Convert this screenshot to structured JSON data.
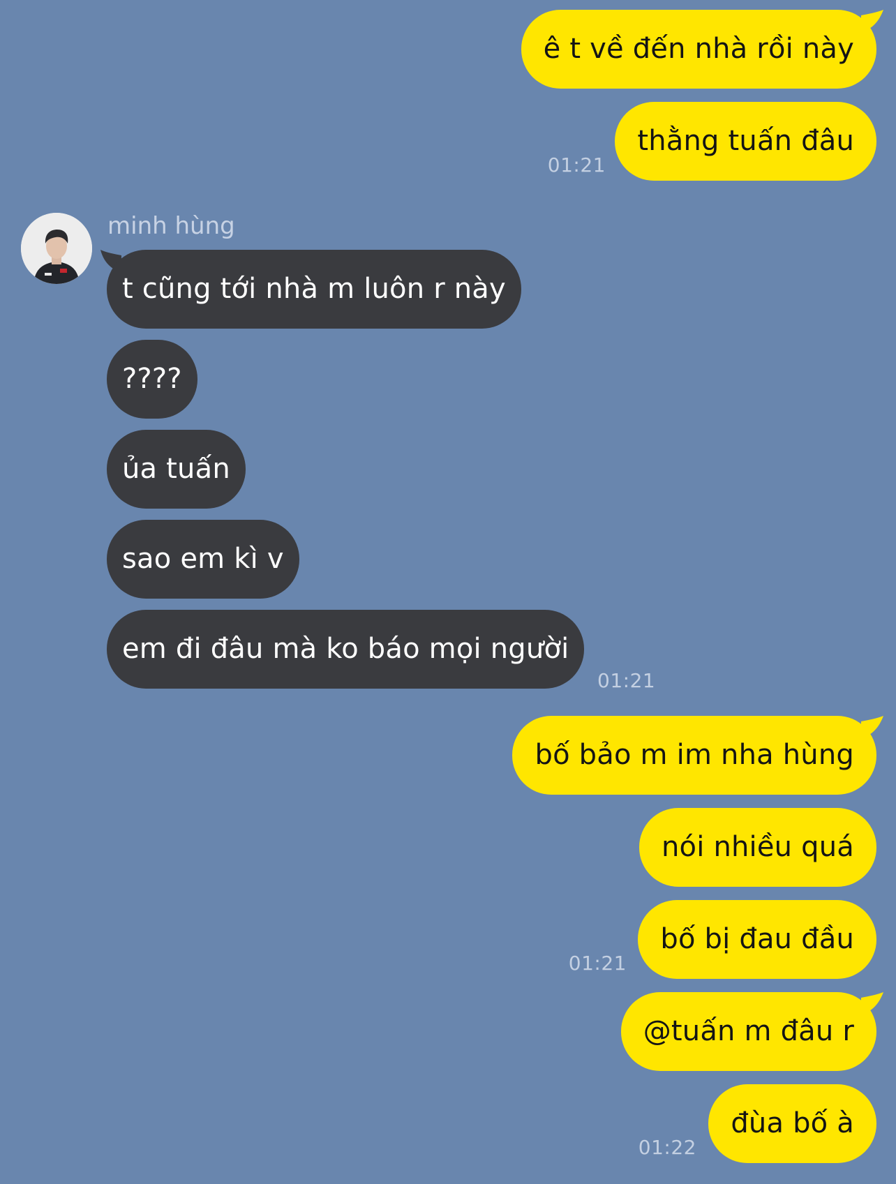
{
  "theme": {
    "background": "#6986AE",
    "outgoing_bubble": "#FFE600",
    "incoming_bubble": "#3A3B3F",
    "timestamp_color": "#C4D0E2"
  },
  "contact": {
    "name": "minh hùng",
    "avatar_icon": "person-avatar-icon"
  },
  "messages": [
    {
      "direction": "out",
      "text": "ê t về đến nhà rồi này"
    },
    {
      "direction": "out",
      "text": "thằng tuấn đâu",
      "time": "01:21"
    },
    {
      "direction": "in",
      "text": "t cũng tới nhà m luôn r này"
    },
    {
      "direction": "in",
      "text": "????"
    },
    {
      "direction": "in",
      "text": "ủa tuấn"
    },
    {
      "direction": "in",
      "text": "sao em kì v"
    },
    {
      "direction": "in",
      "text": "em đi đâu mà ko báo mọi người",
      "time": "01:21"
    },
    {
      "direction": "out",
      "text": "bố bảo m im nha hùng"
    },
    {
      "direction": "out",
      "text": "nói nhiều quá"
    },
    {
      "direction": "out",
      "text": "bố bị đau đầu",
      "time": "01:21"
    },
    {
      "direction": "out",
      "text": "@tuấn m đâu r"
    },
    {
      "direction": "out",
      "text": "đùa bố à",
      "time": "01:22"
    }
  ]
}
